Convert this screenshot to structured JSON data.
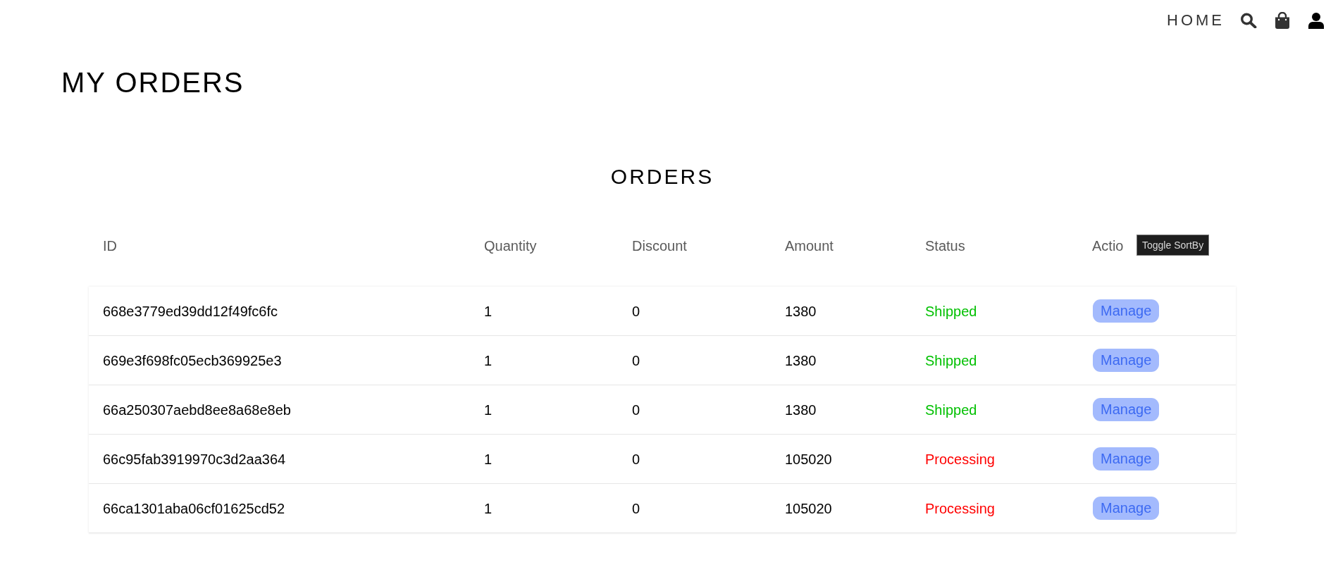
{
  "nav": {
    "home_link": "HOME"
  },
  "page_title": "MY ORDERS",
  "orders": {
    "heading": "ORDERS",
    "columns": [
      "ID",
      "Quantity",
      "Discount",
      "Amount",
      "Status",
      "Actio"
    ],
    "tooltip": "Toggle SortBy",
    "rows": [
      {
        "id": "668e3779ed39dd12f49fc6fc",
        "quantity": "1",
        "discount": "0",
        "amount": "1380",
        "status": "Shipped",
        "color": "#00c000",
        "action": "Manage"
      },
      {
        "id": "669e3f698fc05ecb369925e3",
        "quantity": "1",
        "discount": "0",
        "amount": "1380",
        "status": "Shipped",
        "color": "#00c000",
        "action": "Manage"
      },
      {
        "id": "66a250307aebd8ee8a68e8eb",
        "quantity": "1",
        "discount": "0",
        "amount": "1380",
        "status": "Shipped",
        "color": "#00c000",
        "action": "Manage"
      },
      {
        "id": "66c95fab3919970c3d2aa364",
        "quantity": "1",
        "discount": "0",
        "amount": "105020",
        "status": "Processing",
        "color": "#ff0000",
        "action": "Manage"
      },
      {
        "id": "66ca1301aba06cf01625cd52",
        "quantity": "1",
        "discount": "0",
        "amount": "105020",
        "status": "Processing",
        "color": "#ff0000",
        "action": "Manage"
      }
    ]
  }
}
